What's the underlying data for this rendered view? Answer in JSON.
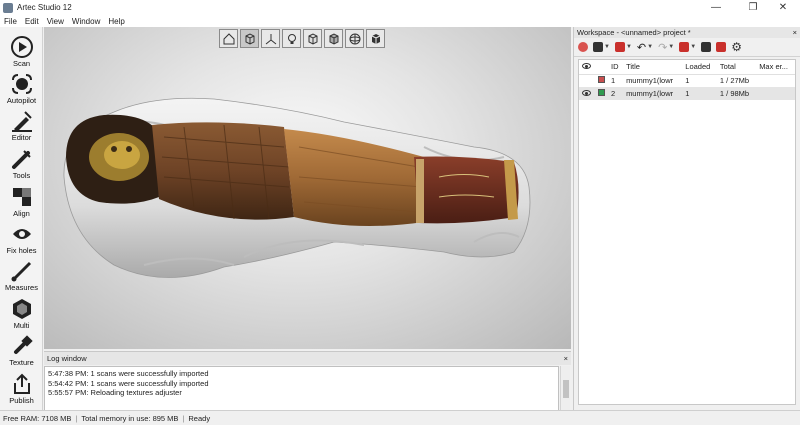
{
  "window": {
    "title": "Artec Studio 12"
  },
  "menu": {
    "file": "File",
    "edit": "Edit",
    "view": "View",
    "window": "Window",
    "help": "Help"
  },
  "tools": [
    {
      "label": "Scan"
    },
    {
      "label": "Autopilot"
    },
    {
      "label": "Editor"
    },
    {
      "label": "Tools"
    },
    {
      "label": "Align"
    },
    {
      "label": "Fix holes"
    },
    {
      "label": "Measures"
    },
    {
      "label": "Multi"
    },
    {
      "label": "Texture"
    },
    {
      "label": "Publish"
    }
  ],
  "workspace": {
    "title": "Workspace - <unnamed> project *",
    "columns": [
      "ID",
      "Title",
      "Loaded",
      "Total",
      "Max er..."
    ],
    "rows": [
      {
        "id": "1",
        "title": "mummy1(lowr",
        "loaded": "1",
        "total": "1 / 27Mb",
        "max_error": "",
        "color": "#c94f4f"
      },
      {
        "id": "2",
        "title": "mummy1(lowr",
        "loaded": "1",
        "total": "1 / 98Mb",
        "max_error": "",
        "color": "#2f9a4f"
      }
    ]
  },
  "log": {
    "title": "Log window",
    "lines": [
      "5:47:38 PM: 1 scans were successfully imported",
      "5:54:42 PM: 1 scans were successfully imported",
      "5:55:57 PM: Reloading textures adjuster"
    ]
  },
  "status": {
    "free_ram": "Free RAM: 7108 MB",
    "total_memory": "Total memory in use: 895 MB",
    "state": "Ready"
  },
  "close_glyph": "×"
}
